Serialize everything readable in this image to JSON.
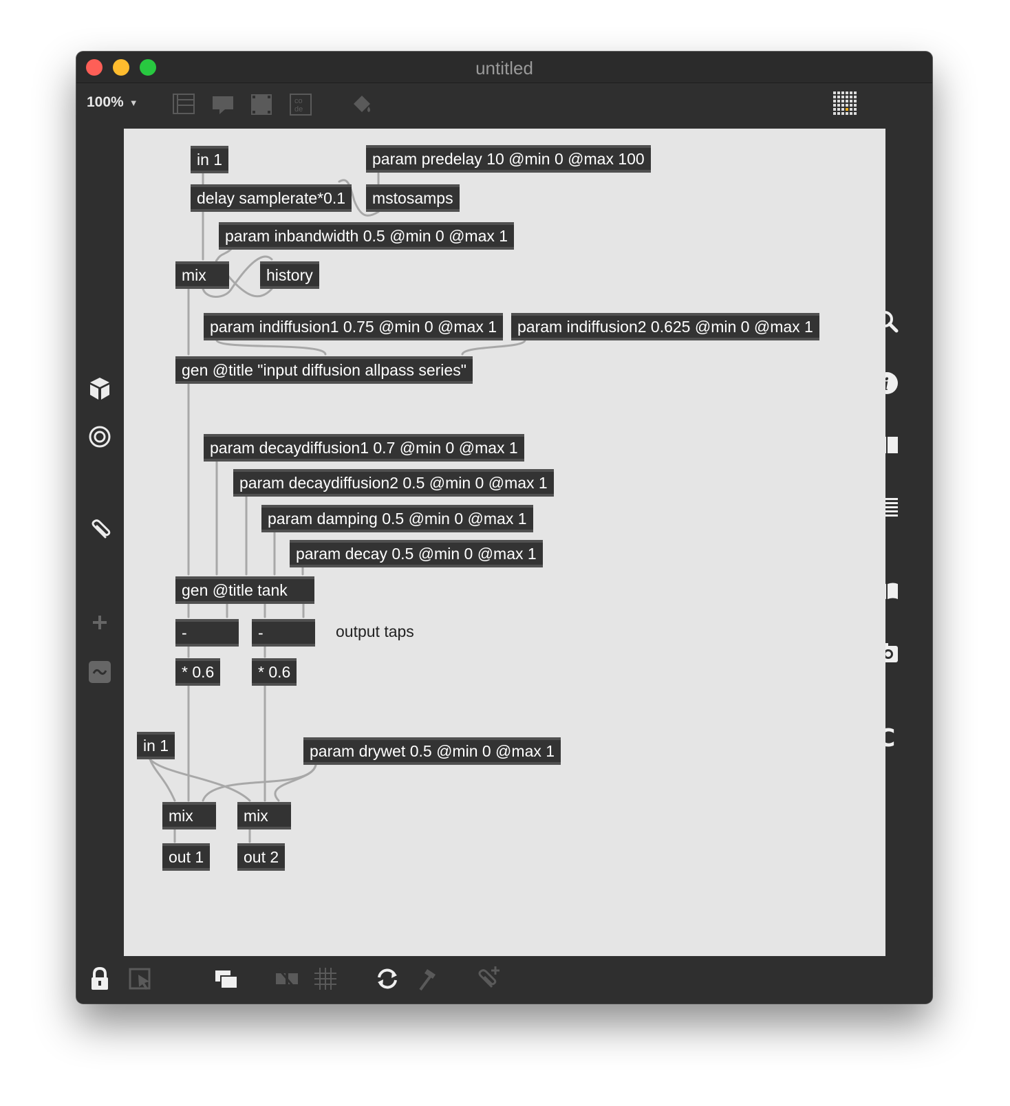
{
  "window": {
    "title": "untitled"
  },
  "toolbar": {
    "zoom": "100%"
  },
  "patch": {
    "objects": {
      "in1_top": "in 1",
      "param_predelay": "param predelay 10 @min 0 @max 100",
      "delay": "delay samplerate*0.1",
      "mstosamps": "mstosamps",
      "param_inbandwidth": "param inbandwidth 0.5 @min 0 @max 1",
      "mix_top": "mix",
      "history": "history",
      "param_indiffusion1": "param indiffusion1 0.75 @min 0 @max 1",
      "param_indiffusion2": "param indiffusion2 0.625 @min 0 @max 1",
      "gen_input": "gen @title \"input diffusion allpass series\"",
      "param_decaydiffusion1": "param decaydiffusion1 0.7 @min 0 @max 1",
      "param_decaydiffusion2": "param decaydiffusion2 0.5 @min 0 @max 1",
      "param_damping": "param damping 0.5 @min 0 @max 1",
      "param_decay": "param decay 0.5 @min 0 @max 1",
      "gen_tank": "gen @title tank",
      "minus_left": "-",
      "minus_right": "-",
      "mul_left": "* 0.6",
      "mul_right": "* 0.6",
      "in1_bottom": "in 1",
      "param_drywet": "param drywet 0.5 @min 0 @max 1",
      "mix_left": "mix",
      "mix_right": "mix",
      "out1": "out 1",
      "out2": "out 2"
    },
    "comment": "output taps"
  },
  "icons": {
    "window_controls": [
      "close-icon",
      "minimize-icon",
      "zoom-icon"
    ],
    "toolbar": [
      "presentation-icon",
      "comment-icon",
      "box-icon",
      "code-icon",
      "paint-bucket-icon",
      "grid-keypad-icon"
    ],
    "left_sidebar": [
      "package-cube-icon",
      "target-icon",
      "paperclip-icon",
      "plus-icon",
      "signal-tilde-icon"
    ],
    "right_sidebar": [
      "search-icon",
      "info-icon",
      "columns-icon",
      "list-icon",
      "book-icon",
      "camera-icon",
      "c-icon"
    ],
    "bottom_bar": [
      "lock-icon",
      "select-arrow-icon",
      "windows-icon",
      "no-align-icon",
      "grid-icon",
      "refresh-icon",
      "hammer-icon",
      "paperclip-plus-icon"
    ]
  },
  "colors": {
    "window": "#2f2f2f",
    "canvas": "#e5e5e5",
    "object_box": "#333333",
    "close": "#fe5f57",
    "minimize": "#febc2e",
    "zoom": "#28c840"
  }
}
